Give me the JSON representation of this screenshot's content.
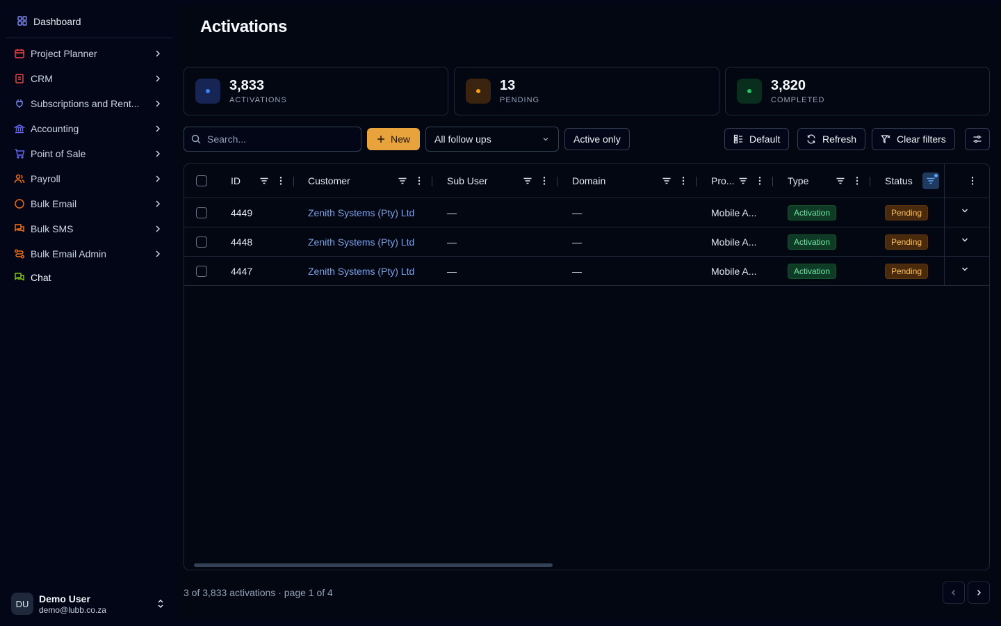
{
  "sidebar": {
    "top": {
      "label": "Dashboard",
      "icon": "dashboard-icon"
    },
    "items": [
      {
        "label": "Project Planner",
        "icon": "calendar-icon",
        "color": "#ef4444"
      },
      {
        "label": "CRM",
        "icon": "receipt-icon",
        "color": "#ef4444"
      },
      {
        "label": "Subscriptions and Rent...",
        "icon": "plug-icon",
        "color": "#818cf8"
      },
      {
        "label": "Accounting",
        "icon": "bank-icon",
        "color": "#6366f1"
      },
      {
        "label": "Point of Sale",
        "icon": "cart-icon",
        "color": "#6366f1"
      },
      {
        "label": "Payroll",
        "icon": "users-icon",
        "color": "#f97316"
      },
      {
        "label": "Bulk Email",
        "icon": "circle-icon",
        "color": "#f97316"
      },
      {
        "label": "Bulk SMS",
        "icon": "messages-icon",
        "color": "#f97316"
      },
      {
        "label": "Bulk Email Admin",
        "icon": "route-icon",
        "color": "#f97316"
      },
      {
        "label": "Chat",
        "icon": "chat-icon",
        "color": "#84cc16"
      }
    ],
    "user": {
      "initials": "DU",
      "name": "Demo User",
      "email": "demo@lubb.co.za"
    }
  },
  "page": {
    "title": "Activations"
  },
  "stats": [
    {
      "value": "3,833",
      "caption": "ACTIVATIONS",
      "color": "#3b82f6",
      "bg": "#172554"
    },
    {
      "value": "13",
      "caption": "PENDING",
      "color": "#f59e0b",
      "bg": "#3a2410"
    },
    {
      "value": "3,820",
      "caption": "COMPLETED",
      "color": "#22c55e",
      "bg": "#0a2e1d"
    }
  ],
  "toolbar": {
    "search_placeholder": "Search...",
    "new_label": "New",
    "follow_select": "All follow ups",
    "active_only": "Active only",
    "default_label": "Default",
    "refresh_label": "Refresh",
    "clear_filters_label": "Clear filters"
  },
  "table": {
    "columns": [
      "ID",
      "Customer",
      "Sub User",
      "Domain",
      "Pro...",
      "Type",
      "Status"
    ],
    "rows": [
      {
        "id": "4449",
        "customer": "Zenith Systems (Pty) Ltd",
        "sub_user": "—",
        "domain": "—",
        "product": "Mobile A...",
        "type": "Activation",
        "status": "Pending"
      },
      {
        "id": "4448",
        "customer": "Zenith Systems (Pty) Ltd",
        "sub_user": "—",
        "domain": "—",
        "product": "Mobile A...",
        "type": "Activation",
        "status": "Pending"
      },
      {
        "id": "4447",
        "customer": "Zenith Systems (Pty) Ltd",
        "sub_user": "—",
        "domain": "—",
        "product": "Mobile A...",
        "type": "Activation",
        "status": "Pending"
      }
    ]
  },
  "footer": {
    "summary": "3 of 3,833 activations · page 1 of 4"
  }
}
